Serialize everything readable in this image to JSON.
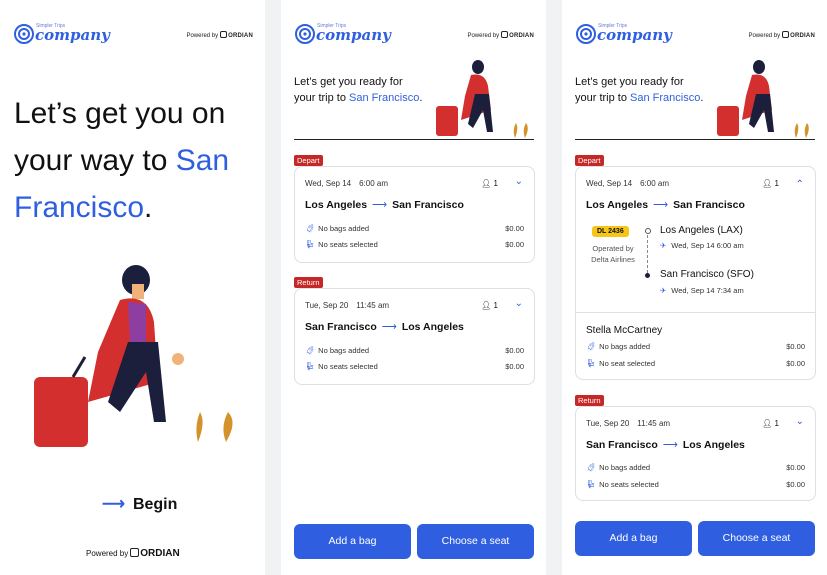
{
  "brand": {
    "tagline": "Simpler Trips",
    "name": "company",
    "powered_by": "Powered by",
    "partner": "ORDIAN",
    "accent": "#2f5fe0",
    "danger": "#c62828"
  },
  "screen1": {
    "hero_line1": "Let’s get you on",
    "hero_line2_prefix": "your way to ",
    "hero_city_a": "San",
    "hero_city_b": "Francisco",
    "hero_end": ".",
    "begin_label": "Begin"
  },
  "ready": {
    "prefix": "Let’s get you ready for your trip to ",
    "city": "San Francisco",
    "suffix": "."
  },
  "depart": {
    "tag": "Depart",
    "date": "Wed, Sep 14",
    "time": "6:00 am",
    "pax": "1",
    "from": "Los Angeles",
    "to": "San Francisco",
    "bags": "No bags added",
    "bags_amount": "$0.00",
    "seats": "No seats selected",
    "seats_amount": "$0.00"
  },
  "return": {
    "tag": "Return",
    "date": "Tue, Sep 20",
    "time": "11:45 am",
    "pax": "1",
    "from": "San Francisco",
    "to": "Los Angeles",
    "bags": "No bags added",
    "bags_amount": "$0.00",
    "seats": "No seats selected",
    "seats_amount": "$0.00"
  },
  "expanded": {
    "flight_no": "DL 2436",
    "operated_by": "Operated by",
    "carrier": "Delta Airlines",
    "origin": "Los Angeles (LAX)",
    "origin_dt": "Wed, Sep 14   6:00 am",
    "dest": "San Francisco (SFO)",
    "dest_dt": "Wed, Sep 14   7:34 am",
    "passenger": "Stella McCartney",
    "bags": "No bags added",
    "bags_amount": "$0.00",
    "seat": "No seat selected",
    "seat_amount": "$0.00"
  },
  "actions": {
    "add_bag": "Add a bag",
    "choose_seat": "Choose a seat"
  }
}
